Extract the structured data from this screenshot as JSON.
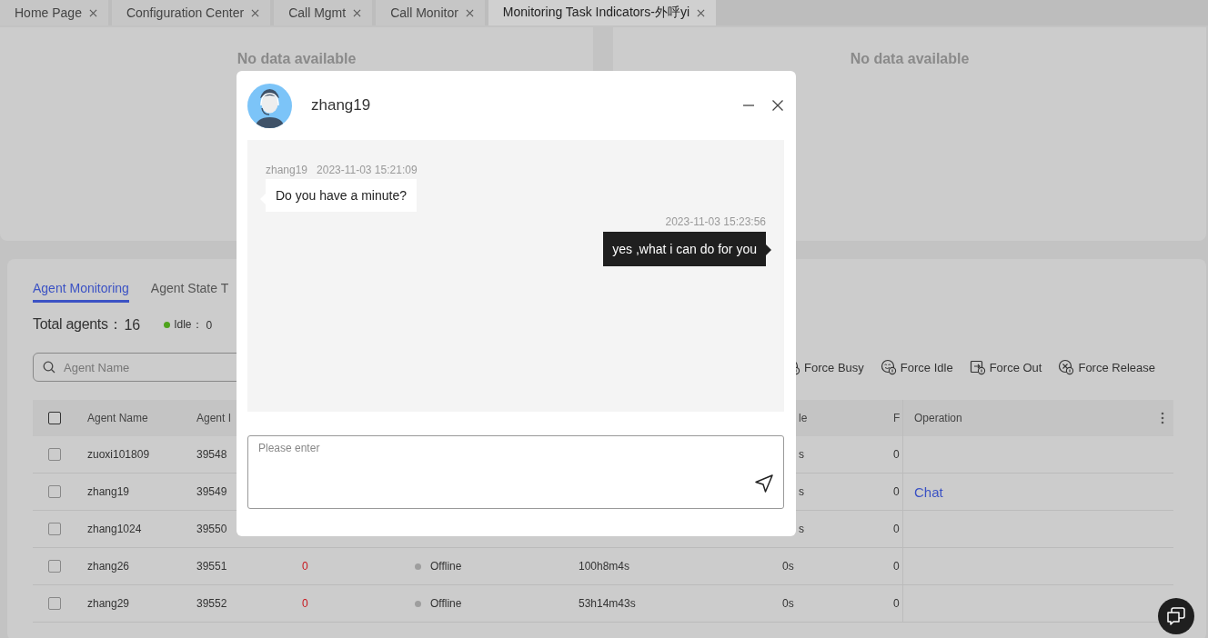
{
  "tabs": [
    {
      "label": "Home Page",
      "selected": false
    },
    {
      "label": "Configuration Center",
      "selected": false
    },
    {
      "label": "Call Mgmt",
      "selected": false
    },
    {
      "label": "Call Monitor",
      "selected": false
    },
    {
      "label": "Monitoring Task Indicators-外呼yi",
      "selected": true
    }
  ],
  "panels": [
    {
      "message": "No data available"
    },
    {
      "message": "No data available"
    }
  ],
  "monitor": {
    "tabs": [
      {
        "label": "Agent Monitoring",
        "selected": true
      },
      {
        "label": "Agent State T",
        "selected": false
      }
    ],
    "total_label": "Total agents：",
    "total": "16",
    "stats": [
      {
        "label": "Idle：",
        "count": "0",
        "color": "#4ea31c"
      }
    ],
    "search": {
      "placeholder": "Agent Name"
    },
    "actions": [
      {
        "kind": "busy",
        "label": "Force Busy"
      },
      {
        "kind": "idle",
        "label": "Force Idle"
      },
      {
        "kind": "out",
        "label": "Force Out"
      },
      {
        "kind": "release",
        "label": "Force Release"
      }
    ],
    "table": {
      "header_checked": false,
      "columns": {
        "agent_name": "Agent Name",
        "agent_id": "Agent I",
        "column_6": "le",
        "column_7": "F",
        "operation": "Operation"
      },
      "rows": [
        {
          "checked": false,
          "agent_name": "zuoxi101809",
          "agent_id": "39548",
          "column_6": "s",
          "column_7": "0"
        },
        {
          "checked": false,
          "agent_name": "zhang19",
          "agent_id": "39549",
          "column_6": "s",
          "column_7": "0",
          "operation": "Chat"
        },
        {
          "checked": false,
          "agent_name": "zhang1024",
          "agent_id": "39550",
          "column_6": "s",
          "column_7": "0"
        },
        {
          "checked": false,
          "agent_name": "zhang26",
          "agent_id": "39551",
          "column_3": "0",
          "status": {
            "label": "Offline",
            "color": "#9e9e9e"
          },
          "column_5": "100h8m4s",
          "column_6": "0s",
          "column_7": "0"
        },
        {
          "checked": false,
          "agent_name": "zhang29",
          "agent_id": "39552",
          "column_3": "0",
          "status": {
            "label": "Offline",
            "color": "#9e9e9e"
          },
          "column_5": "53h14m43s",
          "column_6": "0s",
          "column_7": "0"
        }
      ]
    }
  },
  "chat": {
    "contact": "zhang19",
    "messages": [
      {
        "kind": "incoming",
        "sender": "zhang19",
        "time": "2023-11-03 15:21:09",
        "text": "Do you have a minute?"
      },
      {
        "kind": "outgoing",
        "time": "2023-11-03 15:23:56",
        "text": "yes ,what i can do for you"
      }
    ],
    "input": {
      "placeholder": "Please enter"
    }
  }
}
